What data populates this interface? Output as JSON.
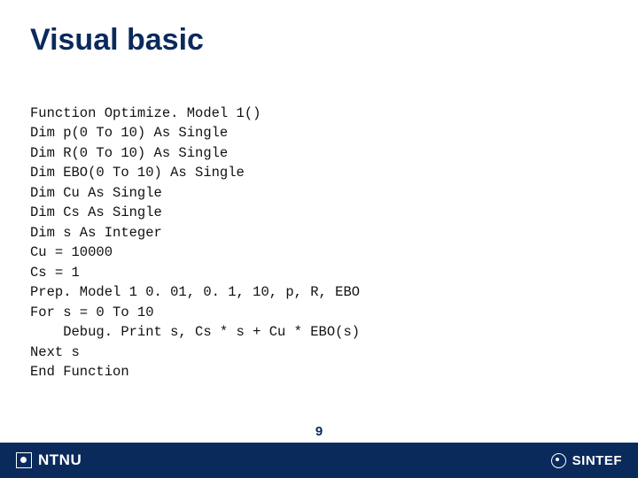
{
  "title": "Visual basic",
  "code": {
    "lines": [
      "Function Optimize. Model 1()",
      "Dim p(0 To 10) As Single",
      "Dim R(0 To 10) As Single",
      "Dim EBO(0 To 10) As Single",
      "Dim Cu As Single",
      "Dim Cs As Single",
      "Dim s As Integer",
      "Cu = 10000",
      "Cs = 1",
      "Prep. Model 1 0. 01, 0. 1, 10, p, R, EBO",
      "For s = 0 To 10",
      "    Debug. Print s, Cs * s + Cu * EBO(s)",
      "Next s",
      "End Function"
    ]
  },
  "page_number": "9",
  "footer": {
    "left_logo_text": "NTNU",
    "right_logo_text": "SINTEF"
  }
}
